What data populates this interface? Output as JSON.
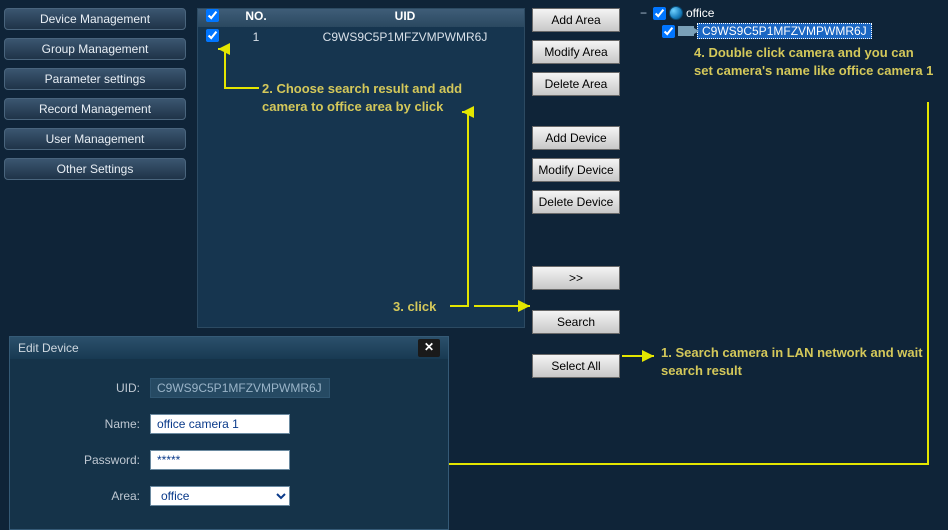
{
  "nav": {
    "items": [
      "Device Management",
      "Group Management",
      "Parameter settings",
      "Record Management",
      "User Management",
      "Other Settings"
    ]
  },
  "search_table": {
    "headers": {
      "no": "NO.",
      "uid": "UID"
    },
    "rows": [
      {
        "checked": true,
        "no": "1",
        "uid": "C9WS9C5P1MFZVMPWMR6J"
      }
    ]
  },
  "mid_buttons": {
    "add_area": "Add Area",
    "modify_area": "Modify Area",
    "delete_area": "Delete Area",
    "add_device": "Add Device",
    "modify_device": "Modify Device",
    "delete_device": "Delete Device",
    "move": ">>",
    "search": "Search",
    "select_all": "Select All"
  },
  "tree": {
    "root": {
      "label": "office",
      "checked": true,
      "expanded": true
    },
    "child": {
      "label": "C9WS9C5P1MFZVMPWMR6J",
      "checked": true
    }
  },
  "annotations": {
    "a1": "1. Search camera in LAN network and wait search result",
    "a2": "2. Choose search result and add camera to office area by click",
    "a3": "3. click",
    "a4": "4. Double click camera and you can set camera's name like office camera 1"
  },
  "dialog": {
    "title": "Edit Device",
    "uid_label": "UID:",
    "uid_value": "C9WS9C5P1MFZVMPWMR6J",
    "name_label": "Name:",
    "name_value": "office camera 1",
    "pwd_label": "Password:",
    "pwd_value": "*****",
    "area_label": "Area:",
    "area_value": "office"
  }
}
